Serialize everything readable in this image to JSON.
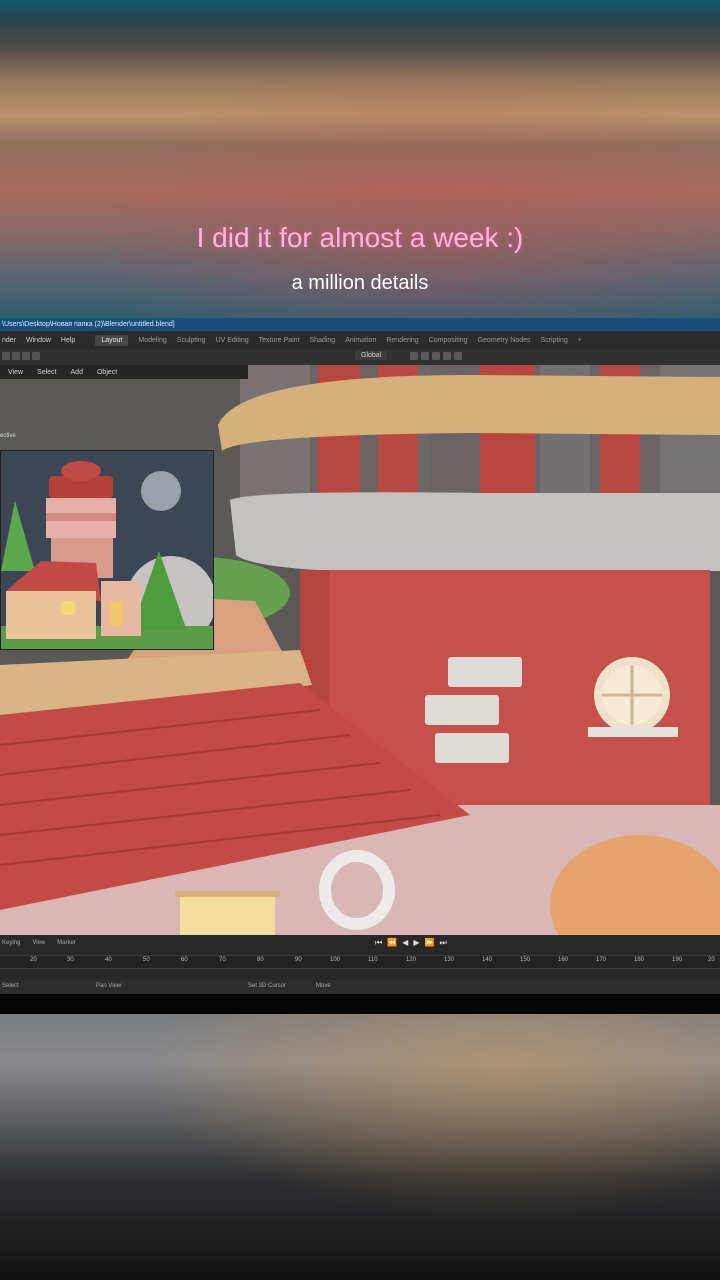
{
  "caption": {
    "main": "I did it for almost a week :)",
    "sub": "a million details"
  },
  "blender": {
    "title": "\\Users\\Desktop\\Новая папка (2)\\Blender\\untitled.blend]",
    "menu": [
      "nder",
      "Window",
      "Help"
    ],
    "workspaces": [
      "Layout",
      "Modeling",
      "Sculpting",
      "UV Editing",
      "Texture Paint",
      "Shading",
      "Animation",
      "Rendering",
      "Compositing",
      "Geometry Nodes",
      "Scripting"
    ],
    "add_tab": "+",
    "orientation": "Global",
    "viewport_menu": [
      "View",
      "Select",
      "Add",
      "Object"
    ],
    "persp_label": "ective",
    "timeline_menu": [
      "Keying",
      "View",
      "Marker"
    ],
    "ruler_ticks": [
      "20",
      "30",
      "40",
      "50",
      "60",
      "70",
      "80",
      "90",
      "100",
      "110",
      "120",
      "130",
      "140",
      "150",
      "160",
      "170",
      "180",
      "190",
      "20"
    ],
    "playback": [
      "⏮",
      "⏪",
      "◀",
      "▶",
      "⏩",
      "⏭"
    ],
    "status": [
      "Select",
      "Pan View",
      "Set 3D Cursor",
      "Move"
    ]
  }
}
